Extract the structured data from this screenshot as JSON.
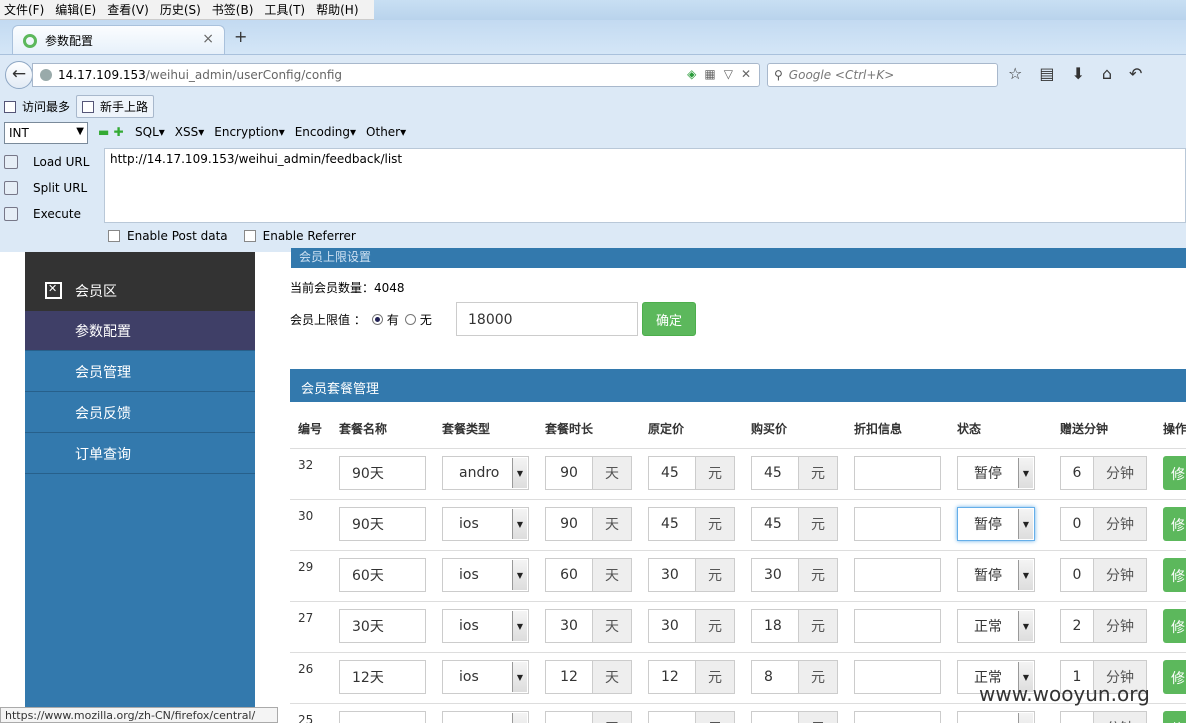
{
  "menubar": [
    "文件(F)",
    "编辑(E)",
    "查看(V)",
    "历史(S)",
    "书签(B)",
    "工具(T)",
    "帮助(H)"
  ],
  "tab": {
    "title": "参数配置",
    "close": "×",
    "new": "+"
  },
  "url": {
    "host": "14.17.109.153",
    "path": "/weihui_admin/userConfig/config"
  },
  "search": {
    "placeholder": "Google <Ctrl+K>"
  },
  "bookmarks": [
    "访问最多",
    "新手上路"
  ],
  "hackbar": {
    "select": "INT",
    "menus": [
      "SQL▾",
      "XSS▾",
      "Encryption▾",
      "Encoding▾",
      "Other▾"
    ],
    "load": "Load URL",
    "split": "Split URL",
    "execute": "Execute",
    "textarea": "http://14.17.109.153/weihui_admin/feedback/list",
    "post": "Enable Post data",
    "referrer": "Enable Referrer"
  },
  "sidebar": {
    "head": "会员区",
    "items": [
      "参数配置",
      "会员管理",
      "会员反馈",
      "订单查询"
    ]
  },
  "overbar": "会员上限设置",
  "member_count": "当前会员数量：4048",
  "limit": {
    "label": "会员上限值 ：",
    "yes": "有",
    "no": "无",
    "value": "18000",
    "confirm": "确定"
  },
  "pkg": {
    "title": "会员套餐管理",
    "headers": [
      "编号",
      "套餐名称",
      "套餐类型",
      "套餐时长",
      "原定价",
      "购买价",
      "折扣信息",
      "状态",
      "赠送分钟",
      "操作"
    ],
    "unit_day": "天",
    "unit_yuan": "元",
    "unit_min": "分钟",
    "btn": "修",
    "rows": [
      {
        "id": "32",
        "name": "90天",
        "type": "andro",
        "days": "90",
        "orig": "45",
        "price": "45",
        "disc": "",
        "status": "暂停",
        "mins": "6"
      },
      {
        "id": "30",
        "name": "90天",
        "type": "ios",
        "days": "90",
        "orig": "45",
        "price": "45",
        "disc": "",
        "status": "暂停",
        "mins": "0"
      },
      {
        "id": "29",
        "name": "60天",
        "type": "ios",
        "days": "60",
        "orig": "30",
        "price": "30",
        "disc": "",
        "status": "暂停",
        "mins": "0"
      },
      {
        "id": "27",
        "name": "30天",
        "type": "ios",
        "days": "30",
        "orig": "30",
        "price": "18",
        "disc": "",
        "status": "正常",
        "mins": "2"
      },
      {
        "id": "26",
        "name": "12天",
        "type": "ios",
        "days": "12",
        "orig": "12",
        "price": "8",
        "disc": "",
        "status": "正常",
        "mins": "1"
      },
      {
        "id": "25",
        "name": "",
        "type": "",
        "days": "",
        "orig": "",
        "price": "",
        "disc": "",
        "status": "",
        "mins": ""
      }
    ]
  },
  "statusbar": "https://www.mozilla.org/zh-CN/firefox/central/",
  "watermark": "www.wooyun.org"
}
